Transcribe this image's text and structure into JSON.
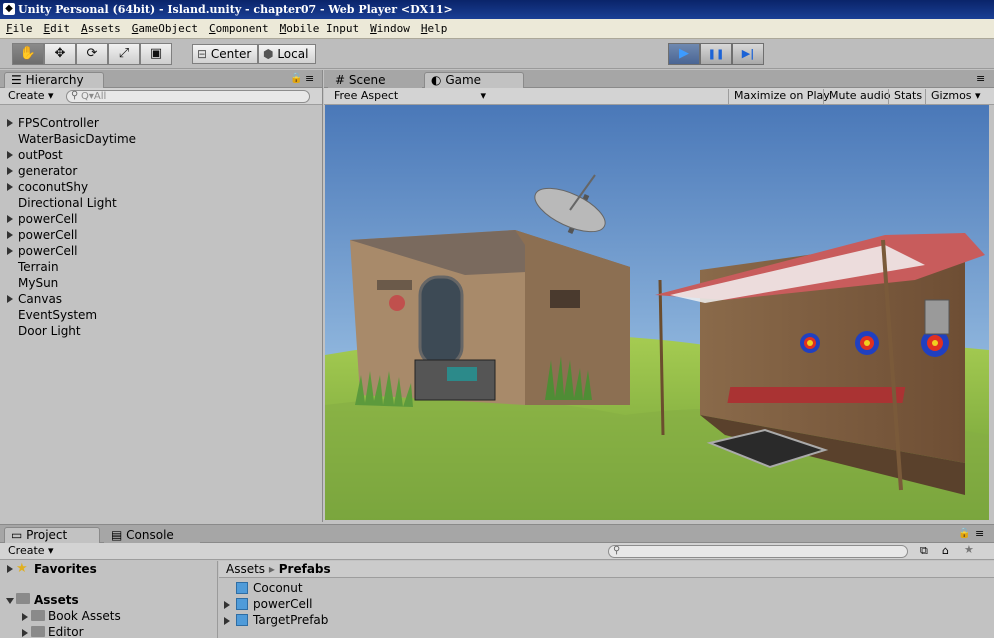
{
  "window": {
    "title": "Unity Personal (64bit) - Island.unity - chapter07 - Web Player <DX11>",
    "icon": "unity-icon"
  },
  "menu": [
    "File",
    "Edit",
    "Assets",
    "GameObject",
    "Component",
    "Mobile Input",
    "Window",
    "Help"
  ],
  "toolbar": {
    "tools": [
      "hand-icon",
      "move-icon",
      "rotate-icon",
      "scale-icon",
      "rect-icon"
    ],
    "pivot_label": "Center",
    "space_label": "Local",
    "play": {
      "play": "▶",
      "pause": "❚❚",
      "step": "▶|"
    }
  },
  "hierarchy": {
    "tab_label": "Hierarchy",
    "create_label": "Create",
    "search_placeholder": "Q▾All",
    "items": [
      {
        "label": "FPSController",
        "expandable": true
      },
      {
        "label": "WaterBasicDaytime",
        "expandable": false
      },
      {
        "label": "outPost",
        "expandable": true
      },
      {
        "label": "generator",
        "expandable": true
      },
      {
        "label": "coconutShy",
        "expandable": true
      },
      {
        "label": "Directional Light",
        "expandable": false
      },
      {
        "label": "powerCell",
        "expandable": true
      },
      {
        "label": "powerCell",
        "expandable": true
      },
      {
        "label": "powerCell",
        "expandable": true
      },
      {
        "label": "Terrain",
        "expandable": false
      },
      {
        "label": "MySun",
        "expandable": false
      },
      {
        "label": "Canvas",
        "expandable": true
      },
      {
        "label": "EventSystem",
        "expandable": false
      },
      {
        "label": "Door Light",
        "expandable": false
      }
    ]
  },
  "game_view": {
    "tabs": [
      {
        "label": "Scene",
        "icon": "grid-icon"
      },
      {
        "label": "Game",
        "icon": "pacman-icon"
      }
    ],
    "aspect": "Free Aspect",
    "controls": [
      "Maximize on Play",
      "Mute audio",
      "Stats",
      "Gizmos"
    ]
  },
  "project": {
    "tabs": [
      {
        "label": "Project",
        "icon": "folder-icon"
      },
      {
        "label": "Console",
        "icon": "console-icon"
      }
    ],
    "create_label": "Create",
    "tree": [
      {
        "label": "Favorites",
        "icon": "star-icon"
      },
      {
        "label": "Assets",
        "icon": "folder-icon"
      },
      {
        "label": "Book Assets",
        "icon": "folder-icon"
      },
      {
        "label": "Editor",
        "icon": "folder-icon"
      }
    ],
    "breadcrumb": {
      "root": "Assets",
      "sep": "▸",
      "current": "Prefabs"
    },
    "files": [
      {
        "label": "Coconut",
        "icon": "prefab-cube-icon",
        "expandable": false
      },
      {
        "label": "powerCell",
        "icon": "prefab-cube-icon",
        "expandable": true
      },
      {
        "label": "TargetPrefab",
        "icon": "prefab-cube-icon",
        "expandable": true
      }
    ]
  },
  "colors": {
    "titlebar": "#0a246a",
    "play_active": "#3d9bff",
    "prefab": "#4f9bd9"
  }
}
